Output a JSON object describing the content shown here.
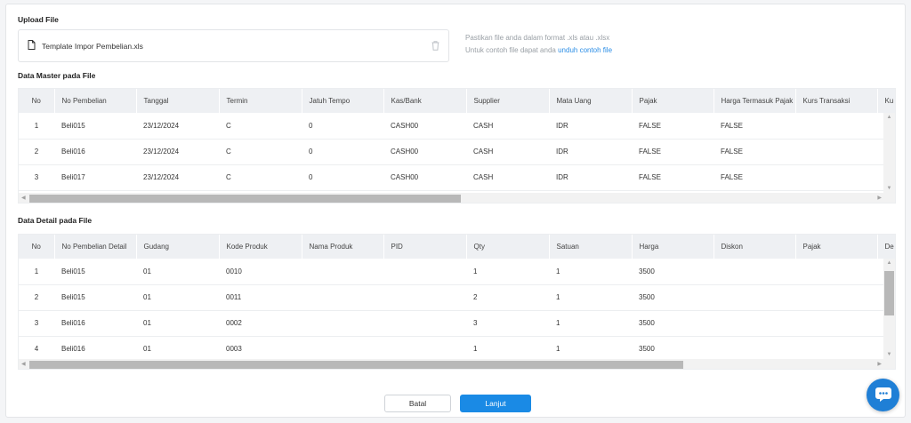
{
  "upload": {
    "title": "Upload File",
    "file_name": "Template Impor Pembelian.xls",
    "hint_line1": "Pastikan file anda dalam format .xls atau .xlsx",
    "hint_line2_prefix": "Untuk contoh file dapat anda",
    "hint_link": "unduh contoh file"
  },
  "master": {
    "title": "Data Master pada File",
    "columns": [
      "No",
      "No Pembelian",
      "Tanggal",
      "Termin",
      "Jatuh Tempo",
      "Kas/Bank",
      "Supplier",
      "Mata Uang",
      "Pajak",
      "Harga Termasuk Pajak",
      "Kurs Transaksi",
      "Ku"
    ],
    "rows": [
      [
        "1",
        "Beli015",
        "23/12/2024",
        "C",
        "0",
        "CASH00",
        "CASH",
        "IDR",
        "FALSE",
        "FALSE",
        "",
        ""
      ],
      [
        "2",
        "Beli016",
        "23/12/2024",
        "C",
        "0",
        "CASH00",
        "CASH",
        "IDR",
        "FALSE",
        "FALSE",
        "",
        ""
      ],
      [
        "3",
        "Beli017",
        "23/12/2024",
        "C",
        "0",
        "CASH00",
        "CASH",
        "IDR",
        "FALSE",
        "FALSE",
        "",
        ""
      ]
    ]
  },
  "detail": {
    "title": "Data Detail pada File",
    "columns": [
      "No",
      "No Pembelian Detail",
      "Gudang",
      "Kode Produk",
      "Nama Produk",
      "PID",
      "Qty",
      "Satuan",
      "Harga",
      "Diskon",
      "Pajak",
      "De"
    ],
    "rows": [
      [
        "1",
        "Beli015",
        "01",
        "0010",
        "",
        "",
        "1",
        "1",
        "3500",
        "",
        "",
        ""
      ],
      [
        "2",
        "Beli015",
        "01",
        "0011",
        "",
        "",
        "2",
        "1",
        "3500",
        "",
        "",
        ""
      ],
      [
        "3",
        "Beli016",
        "01",
        "0002",
        "",
        "",
        "3",
        "1",
        "3500",
        "",
        "",
        ""
      ],
      [
        "4",
        "Beli016",
        "01",
        "0003",
        "",
        "",
        "1",
        "1",
        "3500",
        "",
        "",
        ""
      ]
    ]
  },
  "actions": {
    "cancel_label": "Batal",
    "next_label": "Lanjut"
  },
  "colors": {
    "primary": "#1a8ae5",
    "link": "#2b8ee6",
    "chat": "#1f7fd6"
  },
  "icons": [
    "file-icon",
    "trash-icon",
    "chat-icon"
  ]
}
